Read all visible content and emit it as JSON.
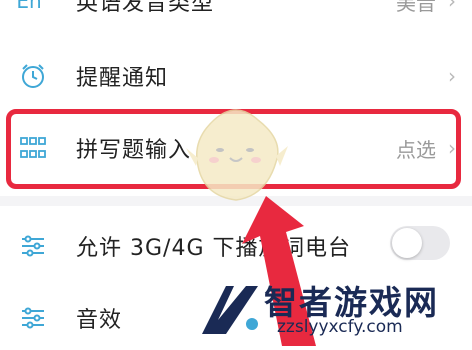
{
  "settings": {
    "rows": [
      {
        "label": "英语发音类型",
        "value": "美音",
        "icon": "language-icon"
      },
      {
        "label": "提醒通知",
        "value": "",
        "icon": "alarm-clock-icon"
      },
      {
        "label": "拼写题输入",
        "value": "点选",
        "icon": "grid-icon"
      },
      {
        "label": "允许 3G/4G 下播放",
        "label_tail": "词电台",
        "icon": "sliders-icon"
      },
      {
        "label": "音效",
        "icon": "sliders-icon"
      }
    ],
    "partial_top_icon_text": "En"
  },
  "watermark": {
    "brand": "智者游戏网",
    "url": "zzslyyxcfy.com"
  },
  "colors": {
    "highlight": "#e8293f",
    "accent": "#3fa7d6",
    "text": "#222222",
    "secondary": "#9a9a9a"
  }
}
